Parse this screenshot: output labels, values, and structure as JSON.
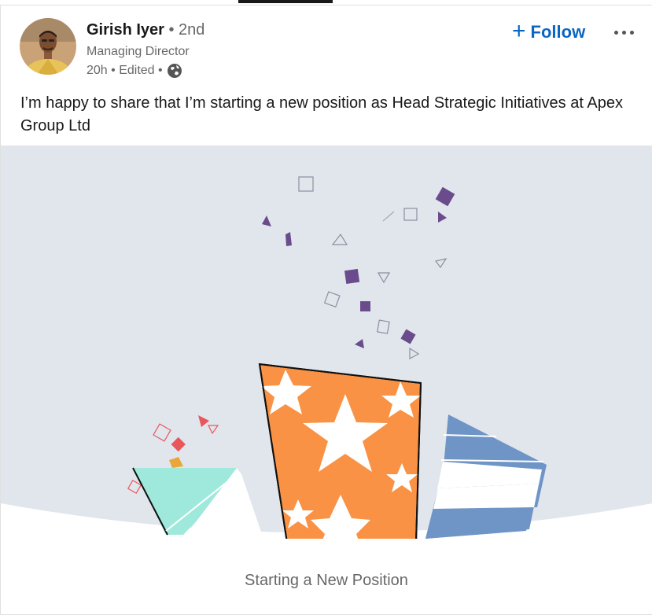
{
  "post": {
    "author": {
      "name": "Girish Iyer",
      "degree": "• 2nd",
      "headline": "Managing Director",
      "time": "20h • Edited •"
    },
    "follow_label": "Follow",
    "text": "I’m happy to share that I’m starting a new position as Head Strategic Initiatives at Apex Group Ltd",
    "caption": "Starting a New Position"
  },
  "icons": {
    "follow": "plus-icon",
    "more": "more-options-icon",
    "visibility": "globe-icon"
  },
  "colors": {
    "accent": "#0a66c2",
    "banner_bg": "#e1e6ed",
    "orange": "#f99244",
    "teal": "#9fe9dc",
    "blue": "#6f94c6",
    "purple": "#6a4c8c",
    "red": "#e9575c"
  }
}
